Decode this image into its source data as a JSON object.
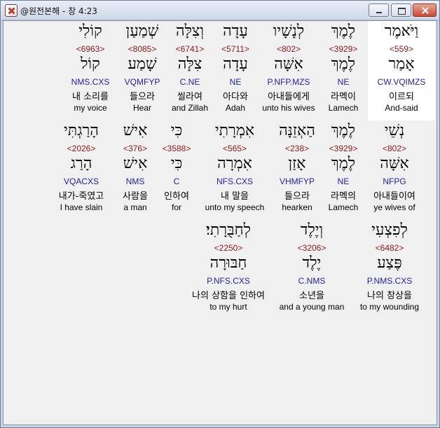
{
  "window": {
    "title": "@원전본해 - 창 4:23"
  },
  "rows": [
    [
      {
        "hebrew": "וַיֹּאמֶר",
        "strong": "<559>",
        "lemma": "אָמַר",
        "morph": "CW.VQIMZS",
        "korean": "이르되",
        "english": "And-said",
        "selected": true
      },
      {
        "hebrew": "לֶמֶךְ",
        "strong": "<3929>",
        "lemma": "לֶמֶךְ",
        "morph": "NE",
        "korean": "라멕이",
        "english": "Lamech"
      },
      {
        "hebrew": "לְנָשָׁיו",
        "strong": "<802>",
        "lemma": "אִשָּׁה",
        "morph": "P.NFP.MZS",
        "korean": "아내들에게",
        "english": "unto his wives"
      },
      {
        "hebrew": "עָדָה",
        "strong": "<5711>",
        "lemma": "עָדָה",
        "morph": "NE",
        "korean": "아다와",
        "english": "Adah"
      },
      {
        "hebrew": "וְצִלָּה",
        "strong": "<6741>",
        "lemma": "צִלָּה",
        "morph": "C.NE",
        "korean": "씰라여",
        "english": "and Zillah"
      },
      {
        "hebrew": "שְׁמַעַן",
        "strong": "<8085>",
        "lemma": "שָׁמַע",
        "morph": "VQMFYP",
        "korean": "들으라",
        "english": "Hear"
      },
      {
        "hebrew": "קוֹלִי",
        "strong": "<6963>",
        "lemma": "קוֹל",
        "morph": "NMS.CXS",
        "korean": "내 소리를",
        "english": "my voice"
      }
    ],
    [
      {
        "hebrew": "נְשֵׁי",
        "strong": "<802>",
        "lemma": "אִשָּׁה",
        "morph": "NFPG",
        "korean": "아내들이여",
        "english": "ye wives of"
      },
      {
        "hebrew": "לֶמֶךְ",
        "strong": "<3929>",
        "lemma": "לֶמֶךְ",
        "morph": "NE",
        "korean": "라멕의",
        "english": "Lamech"
      },
      {
        "hebrew": "הַאְזֵנָּה",
        "strong": "<238>",
        "lemma": "אָזַן",
        "morph": "VHMFYP",
        "korean": "들으라",
        "english": "hearken"
      },
      {
        "hebrew": "אִמְרָתִי",
        "strong": "<565>",
        "lemma": "אִמְרָה",
        "morph": "NFS.CXS",
        "korean": "내 말을",
        "english": "unto my speech"
      },
      {
        "hebrew": "כִּי",
        "strong": "<3588>",
        "lemma": "כִּי",
        "morph": "C",
        "korean": "인하여",
        "english": "for"
      },
      {
        "hebrew": "אִישׁ",
        "strong": "<376>",
        "lemma": "אִישׁ",
        "morph": "NMS",
        "korean": "사람을",
        "english": "a man"
      },
      {
        "hebrew": "הָרַגְתִּי",
        "strong": "<2026>",
        "lemma": "הָרַג",
        "morph": "VQACXS",
        "korean": "내가-죽였고",
        "english": "I have slain"
      }
    ],
    [
      {
        "hebrew": "לְפִצְעִי",
        "strong": "<6482>",
        "lemma": "פֶּצַע",
        "morph": "P.NMS.CXS",
        "korean": "나의 창상을",
        "english": "to my wounding"
      },
      {
        "hebrew": "וְיֶלֶד",
        "strong": "<3206>",
        "lemma": "יֶלֶד",
        "morph": "C.NMS",
        "korean": "소년을",
        "english": "and a young man"
      },
      {
        "hebrew": "לְחַבֻּרָתִי׃",
        "strong": "<2250>",
        "lemma": "חַבּוּרָה",
        "morph": "P.NFS.CXS",
        "korean": "나의 상함을 인하여",
        "english": "to my hurt"
      }
    ]
  ]
}
